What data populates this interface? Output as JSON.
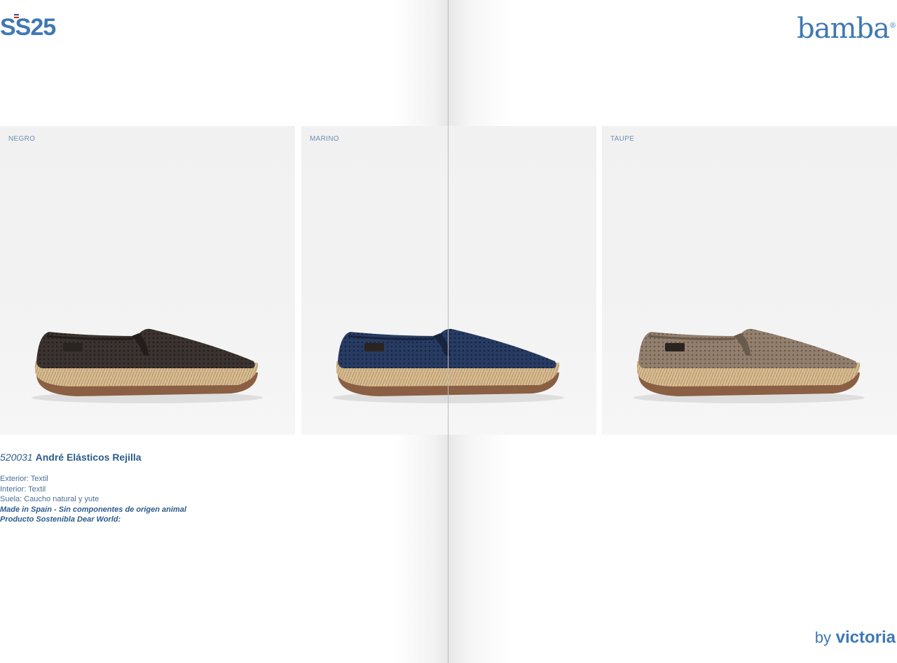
{
  "header": {
    "season": "SS25",
    "brand": "bamba",
    "brand_mark": "®"
  },
  "colors": {
    "brand_blue": "#3f78b3",
    "text_blue": "#2d5b8c",
    "card_bg": "#f2f2f2",
    "sole_rope": "#d9be95",
    "outsole": "#8a5f43"
  },
  "products": [
    {
      "label": "NEGRO",
      "upper": "#3b3330",
      "upper_dark": "#231d1b"
    },
    {
      "label": "MARINO",
      "upper": "#283c63",
      "upper_dark": "#17243f"
    },
    {
      "label": "TAUPE",
      "upper": "#927f6e",
      "upper_dark": "#6a5a4c"
    }
  ],
  "product": {
    "code": "520031",
    "name": "André Elásticos Rejilla",
    "specs": [
      "Exterior: Textil",
      "Interior: Textil",
      "Suela: Caucho natural y yute"
    ],
    "notes": [
      "Made in Spain - Sin componentes de origen animal",
      "Producto Sostenibla Dear World:"
    ]
  },
  "footer": {
    "by": "by",
    "maker": "victoria"
  }
}
